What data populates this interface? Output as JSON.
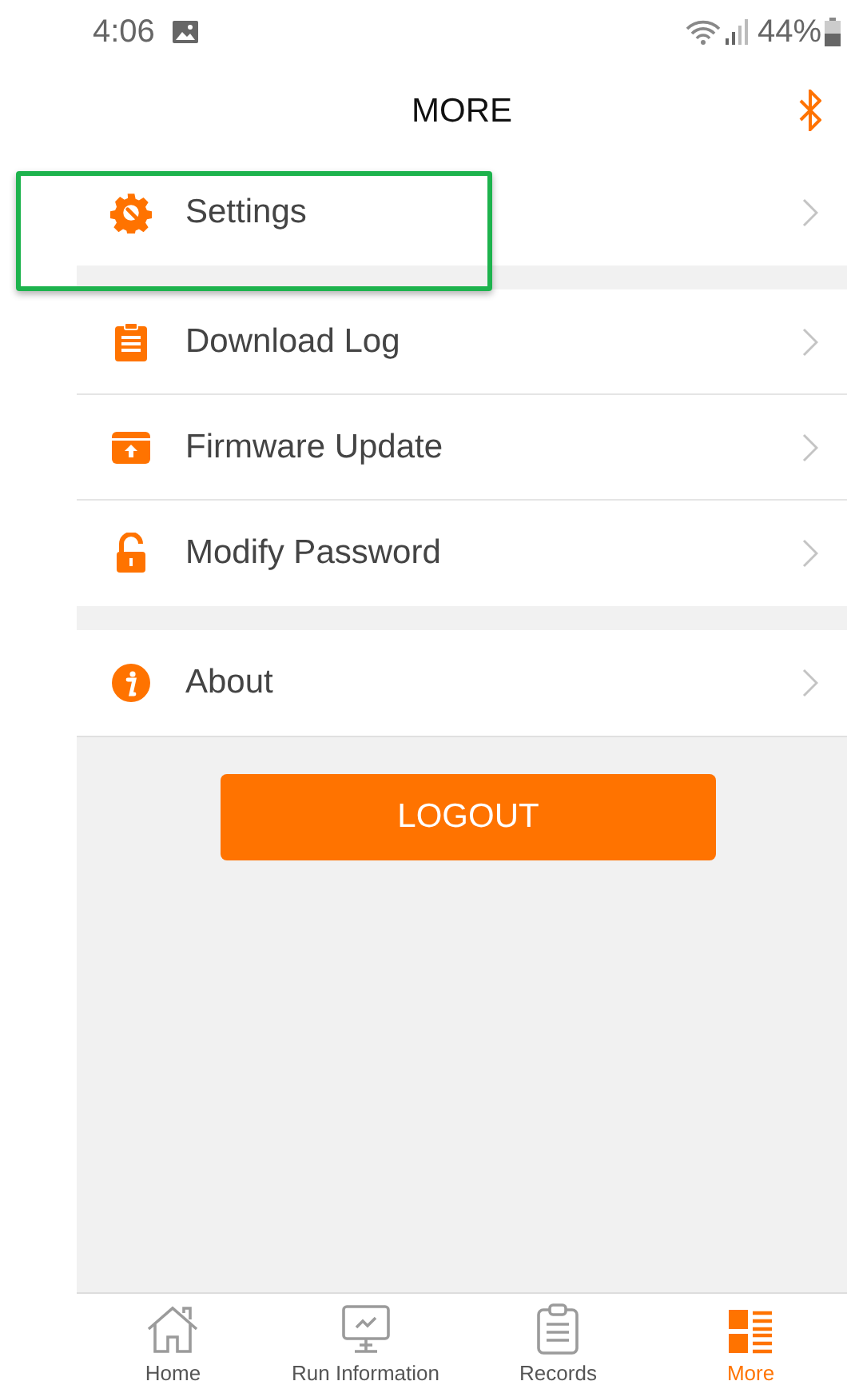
{
  "status_bar": {
    "time": "4:06",
    "battery": "44%"
  },
  "header": {
    "title": "MORE"
  },
  "menu_groups": [
    {
      "items": [
        {
          "kind": "settings",
          "label": "Settings",
          "highlighted": true
        }
      ]
    },
    {
      "items": [
        {
          "kind": "log",
          "label": "Download Log",
          "highlighted": false
        },
        {
          "kind": "firmware",
          "label": "Firmware Update",
          "highlighted": false
        },
        {
          "kind": "password",
          "label": "Modify Password",
          "highlighted": false
        }
      ]
    },
    {
      "items": [
        {
          "kind": "about",
          "label": "About",
          "highlighted": false
        }
      ]
    }
  ],
  "logout_button": "LOGOUT",
  "tabs": [
    {
      "kind": "home",
      "label": "Home",
      "selected": false
    },
    {
      "kind": "run",
      "label": "Run Information",
      "selected": false
    },
    {
      "kind": "records",
      "label": "Records",
      "selected": false
    },
    {
      "kind": "more",
      "label": "More",
      "selected": true
    }
  ]
}
